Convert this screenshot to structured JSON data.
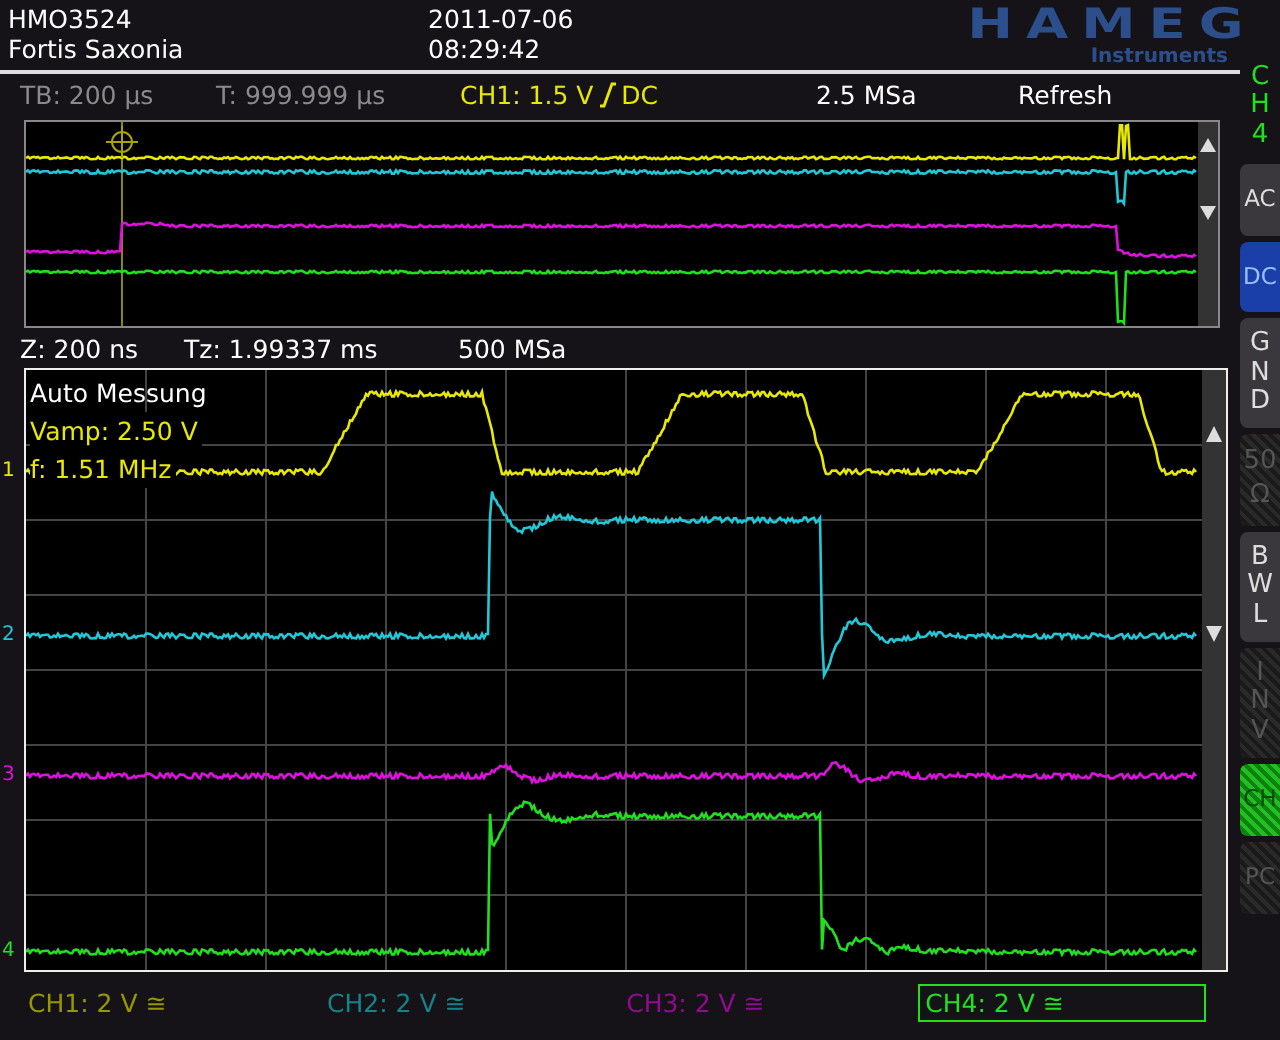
{
  "header": {
    "model": "HMO3524",
    "owner": "Fortis Saxonia",
    "date": "2011-07-06",
    "time": "08:29:42",
    "logo": "HAMEG",
    "logo_sub": "Instruments"
  },
  "status": {
    "timebase": "TB: 200 µs",
    "trigger_time": "T: 999.999 µs",
    "trigger_source": "CH1: 1.5 V",
    "trigger_coupling": "DC",
    "sample_rate": "2.5 MSa",
    "mode": "Refresh"
  },
  "zoom": {
    "zoom_time": "Z: 200 ns",
    "zoom_position": "Tz: 1.99337 ms",
    "sample_rate": "500 MSa"
  },
  "measurements": {
    "title": "Auto Messung",
    "items": [
      "Vamp: 2.50 V",
      "f: 1.51 MHz"
    ]
  },
  "channels": [
    {
      "label": "CH1: 2 V ≅",
      "marker": "1",
      "color": "#e8e800",
      "selected": false
    },
    {
      "label": "CH2: 2 V ≅",
      "marker": "2",
      "color": "#20c8d8",
      "selected": false
    },
    {
      "label": "CH3: 2 V ≅",
      "marker": "3",
      "color": "#e010e0",
      "selected": false
    },
    {
      "label": "CH4: 2 V ≅",
      "marker": "4",
      "color": "#20e020",
      "selected": true
    }
  ],
  "softkeys": {
    "title": "CH4",
    "keys": [
      {
        "label": "AC",
        "kind": "horizontal",
        "selected": false,
        "disabled": false,
        "active": false
      },
      {
        "label": "DC",
        "kind": "horizontal",
        "selected": true,
        "disabled": false,
        "active": false
      },
      {
        "label": "GND",
        "kind": "stacked",
        "selected": false,
        "disabled": false,
        "active": false
      },
      {
        "label": "50 Ω",
        "kind": "wrapped",
        "selected": false,
        "disabled": true,
        "active": false
      },
      {
        "label": "BWL",
        "kind": "stacked",
        "selected": false,
        "disabled": false,
        "active": false
      },
      {
        "label": "INV",
        "kind": "stacked",
        "selected": false,
        "disabled": true,
        "active": false
      },
      {
        "label": "CH",
        "kind": "horizontal",
        "selected": false,
        "disabled": false,
        "active": true
      },
      {
        "label": "PC",
        "kind": "horizontal",
        "selected": false,
        "disabled": true,
        "active": false
      }
    ]
  }
}
